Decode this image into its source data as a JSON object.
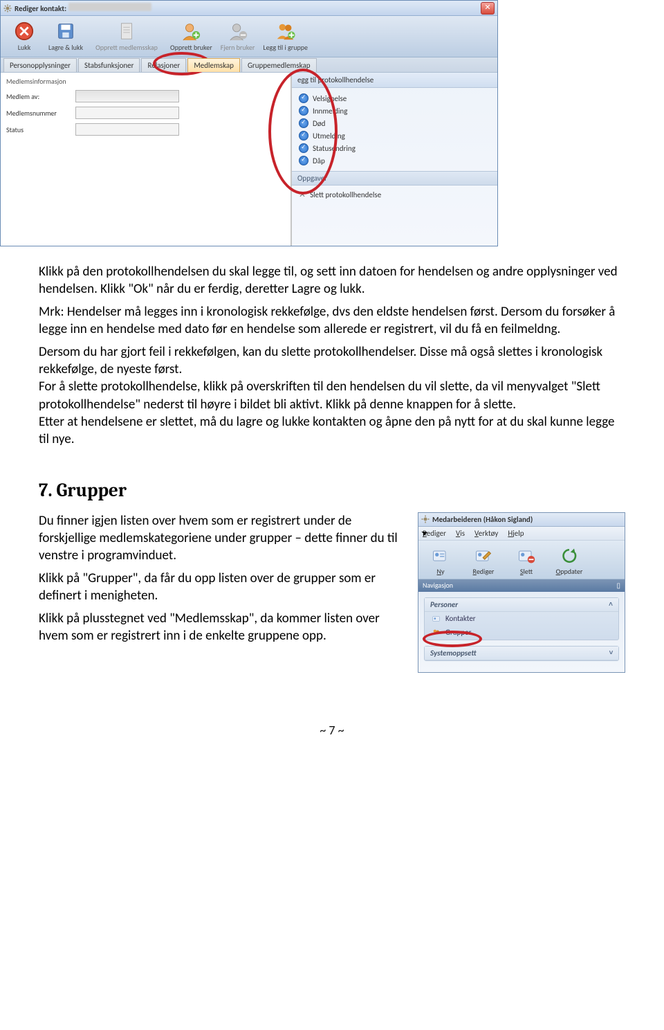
{
  "win1": {
    "title_prefix": "Rediger kontakt:",
    "toolbar": [
      {
        "label": "Lukk",
        "icon": "close-circle",
        "disabled": false
      },
      {
        "label": "Lagre & lukk",
        "icon": "save",
        "disabled": false
      },
      {
        "label": "Opprett medlemsskap",
        "icon": "doc",
        "disabled": true,
        "wide": true
      },
      {
        "label": "Opprett bruker",
        "icon": "user-add",
        "disabled": false
      },
      {
        "label": "Fjern bruker",
        "icon": "user-remove",
        "disabled": true
      },
      {
        "label": "Legg til i gruppe",
        "icon": "users-add",
        "disabled": false
      }
    ],
    "tabs": [
      "Personopplysninger",
      "Stabsfunksjoner",
      "Relasjoner",
      "Medlemskap",
      "Gruppemedlemskap"
    ],
    "active_tab_index": 3,
    "form": {
      "fieldset": "Medlemsinformasjon",
      "rows": [
        {
          "label": "Medlem av:"
        },
        {
          "label": "Medlemsnummer"
        },
        {
          "label": "Status"
        }
      ]
    },
    "side": {
      "heading": "egg til protokollhendelse",
      "items": [
        "Velsignelse",
        "Innmelding",
        "Død",
        "Utmelding",
        "Statusendring",
        "Dåp"
      ],
      "sub": "Oppgaver",
      "action": "Slett protokollhendelse"
    }
  },
  "body": {
    "p1": "Klikk på den protokollhendelsen du skal legge til, og sett inn datoen for hendelsen og andre opplysninger ved hendelsen. Klikk \"Ok\" når du er ferdig, deretter Lagre og lukk.",
    "p2": "Mrk: Hendelser må legges inn i kronologisk rekkefølge, dvs den eldste hendelsen først. Dersom du forsøker å legge inn en hendelse med dato før en hendelse som allerede er registrert, vil du få en feilmeldng.",
    "p3": "Dersom du har gjort feil i rekkefølgen, kan du slette protokollhendelser. Disse må også slettes i kronologisk rekkefølge, de nyeste først.",
    "p4": "For å slette protokollhendelse, klikk på overskriften til den hendelsen du vil slette, da vil menyvalget \"Slett protokollhendelse\" nederst til høyre i bildet bli aktivt. Klikk på denne knappen for å slette.",
    "p5": "Etter at hendelsene er slettet, må du lagre og lukke kontakten og åpne den på nytt for at du skal kunne legge til nye.",
    "h7": "7. Grupper",
    "s7a": "Du finner igjen listen over hvem som er registrert under de forskjellige medlemskategoriene under grupper – dette finner du til venstre i programvinduet.",
    "s7b": "Klikk på \"Grupper\", da får du opp listen over de grupper som er definert i menigheten.",
    "s7c": "Klikk på plusstegnet ved \"Medlemsskap\", da kommer listen over hvem som er registrert inn i de enkelte gruppene opp."
  },
  "win2": {
    "title": "Medarbeideren (Håkon Sigland)",
    "menu": [
      "Rediger",
      "Vis",
      "Verktøy",
      "Hjelp"
    ],
    "toolbar": [
      {
        "label": "Ny",
        "icon": "card-new"
      },
      {
        "label": "Rediger",
        "icon": "card-edit"
      },
      {
        "label": "Slett",
        "icon": "card-del"
      },
      {
        "label": "Oppdater",
        "icon": "refresh"
      }
    ],
    "nav_label": "Navigasjon",
    "groups": [
      {
        "head": "Personer",
        "items": [
          "Kontakter",
          "Grupper"
        ]
      },
      {
        "head": "Systemoppsett",
        "items": []
      }
    ]
  },
  "page_number": "~ 7 ~"
}
